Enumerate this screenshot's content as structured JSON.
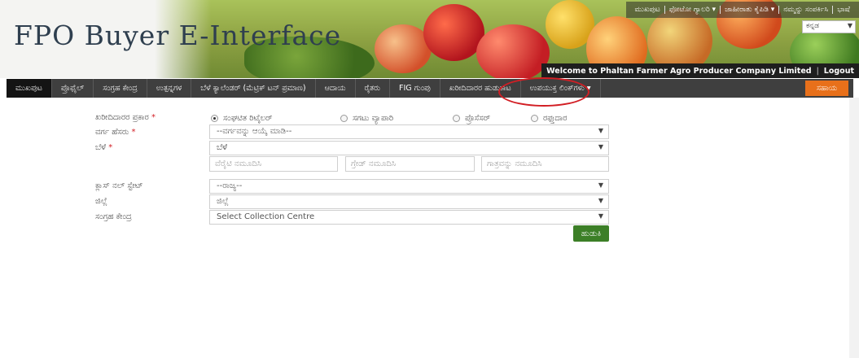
{
  "header": {
    "site_title": "FPO Buyer E-Interface",
    "top_links": [
      "ಮುಖಪುಟ",
      "ಫೋಟೋ ಗ್ಯಾಲರಿ ▾",
      "ಜಾಹೀರಾತು ಕೈಪಿಡಿ ▾",
      "ನಮ್ಮನ್ನು ಸಂಪರ್ಕಿಸಿ",
      "ಭಾಷೆ"
    ],
    "language_select": "ಕನ್ನಡ",
    "welcome_text": "Welcome to Phaltan Farmer Agro Producer Company Limited",
    "logout_label": "Logout"
  },
  "nav": {
    "items": [
      {
        "label": "ಮುಖಪುಟ",
        "active": true
      },
      {
        "label": "ಪ್ರೊಫೈಲ್",
        "active": false
      },
      {
        "label": "ಸಂಗ್ರಹ ಕೇಂದ್ರ",
        "active": false
      },
      {
        "label": "ಉತ್ಪನ್ನಗಳ",
        "active": false
      },
      {
        "label": "ಬೆಳೆ ಕ್ಯಾಲೆಂಡರ್ (ಮೆಟ್ರಿಕ್ ಟನ್ ಪ್ರಮಾಣ)",
        "active": false
      },
      {
        "label": "ಆದಾಯ",
        "active": false
      },
      {
        "label": "ರೈತರು",
        "active": false
      },
      {
        "label": "FIG ಗುಂಪು",
        "active": false
      },
      {
        "label": "ಖರೀದಿದಾರರ ಹುಡುಕಾಟ",
        "active": false
      },
      {
        "label": "ಉಪಯುಕ್ತ ಲಿಂಕ್‌ಗಳು ▾",
        "active": false
      }
    ],
    "right_button": "ಸಹಾಯ"
  },
  "form": {
    "buyer_type_label": "ಖರೀದಿದಾರರ ಪ್ರಕಾರ",
    "buyer_types": [
      {
        "label": "ಸಂಘಟಿತ ರಿಟೈಲರ್",
        "checked": true
      },
      {
        "label": "ಸಗಟು ವ್ಯಾಪಾರಿ",
        "checked": false
      },
      {
        "label": "ಪ್ರೊಸೆಸರ್",
        "checked": false
      },
      {
        "label": "ರಫ್ತುದಾರ",
        "checked": false
      }
    ],
    "category_label": "ವರ್ಗ ಹೆಸರು",
    "category_value": "--ವರ್ಗವನ್ನು ಆಯ್ಕೆ ಮಾಡಿ--",
    "crop_label": "ಬೆಳೆ",
    "crop_value": "ಬೆಳೆ",
    "variety_placeholder": "ವೆರೈಟಿ ನಮೂದಿಸಿ",
    "grade_placeholder": "ಗ್ರೇಡ್ ನಮೂದಿಸಿ",
    "size_placeholder": "ಗಾತ್ರವನ್ನು ನಮೂದಿಸಿ",
    "state_label": "ಕ್ಲಾಸ್ ನಲ್ ಸ್ಟೇಟ್",
    "state_value": "--ರಾಜ್ಯ--",
    "district_label": "ಜಿಲ್ಲೆ",
    "district_value": "ಜಿಲ್ಲೆ",
    "centre_label": "ಸಂಗ್ರಹ ಕೇಂದ್ರ",
    "centre_value": "Select Collection Centre",
    "search_button": "ಹುಡುಕಿ",
    "required_mark": "*"
  },
  "colors": {
    "nav_bg": "#3f3f3f",
    "nav_active": "#141414",
    "accent_orange": "#e8701a",
    "search_green": "#3c7f27",
    "annotation_red": "#d21e24"
  }
}
